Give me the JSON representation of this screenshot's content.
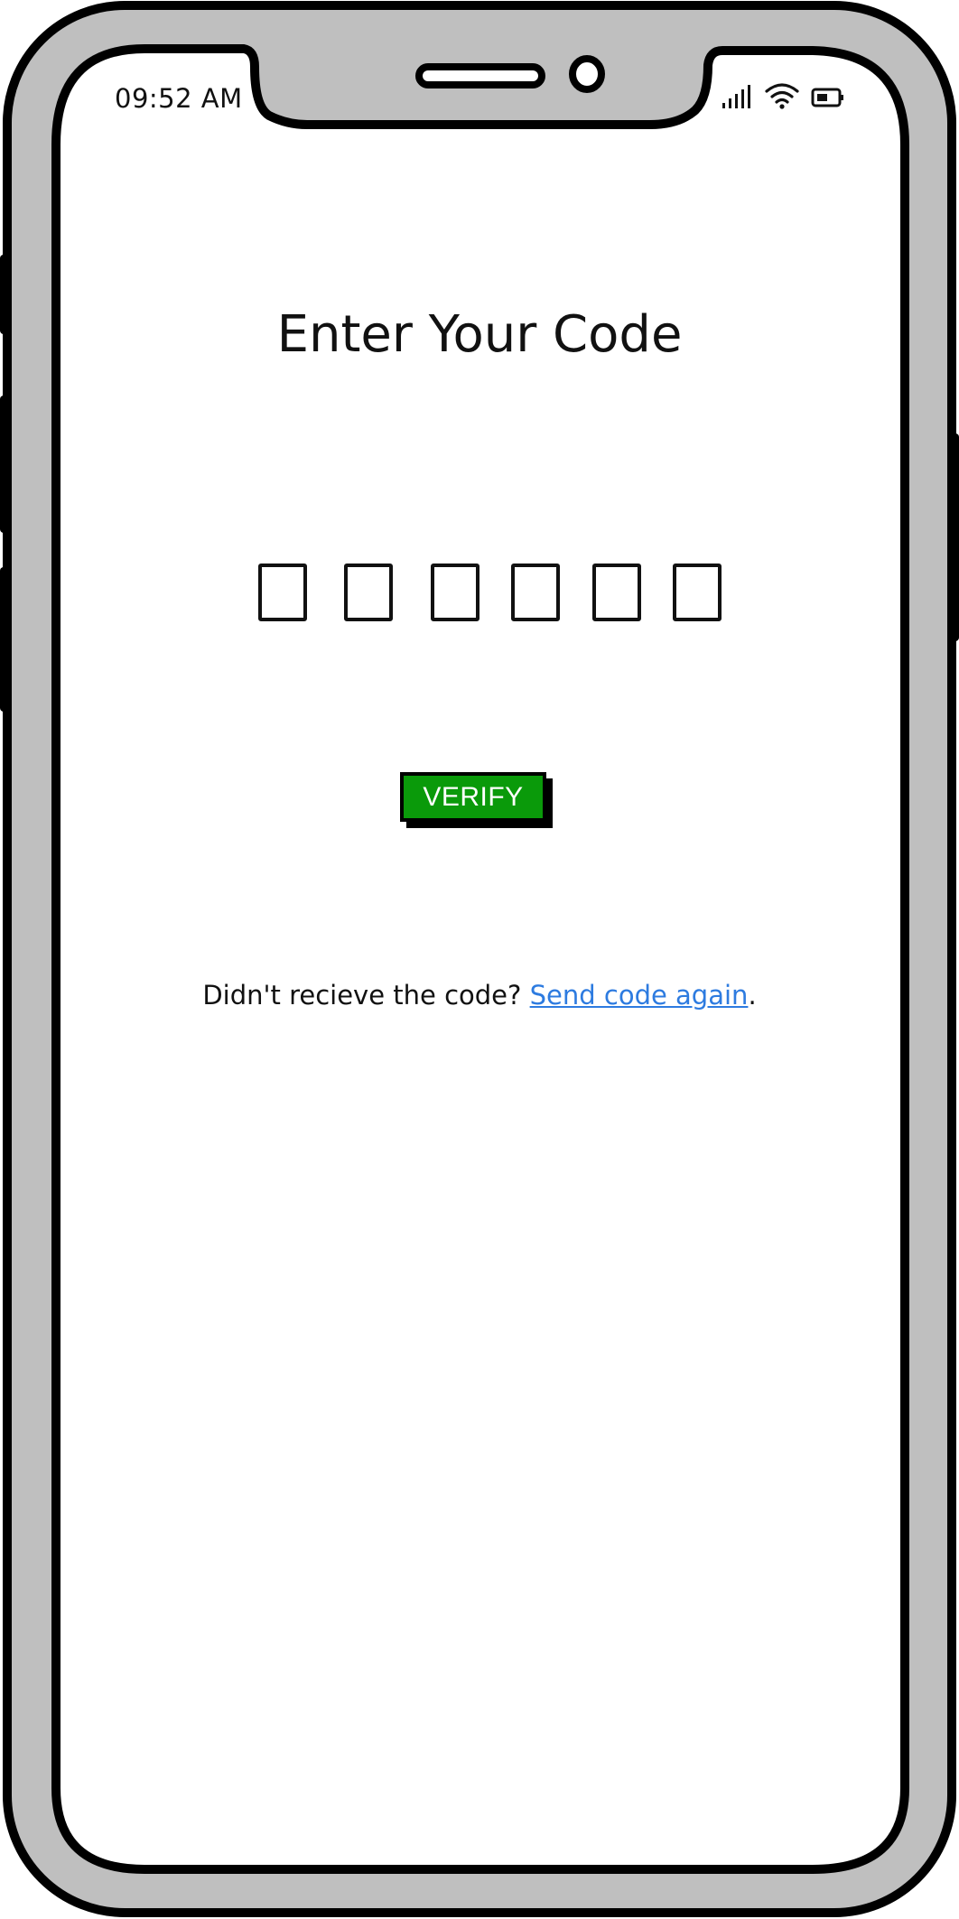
{
  "status_bar": {
    "time": "09:52 AM",
    "icons": [
      "signal-icon",
      "wifi-icon",
      "battery-icon"
    ]
  },
  "screen": {
    "title": "Enter Your Code",
    "code_boxes": [
      "",
      "",
      "",
      "",
      "",
      ""
    ],
    "verify_label": "VERIFY",
    "resend_prompt": "Didn't recieve the code? ",
    "resend_link": "Send code again",
    "resend_suffix": "."
  },
  "colors": {
    "device_body": "#bfbfbf",
    "outline": "#000000",
    "verify_button": "#0a9a0a",
    "link": "#2d7be0"
  }
}
